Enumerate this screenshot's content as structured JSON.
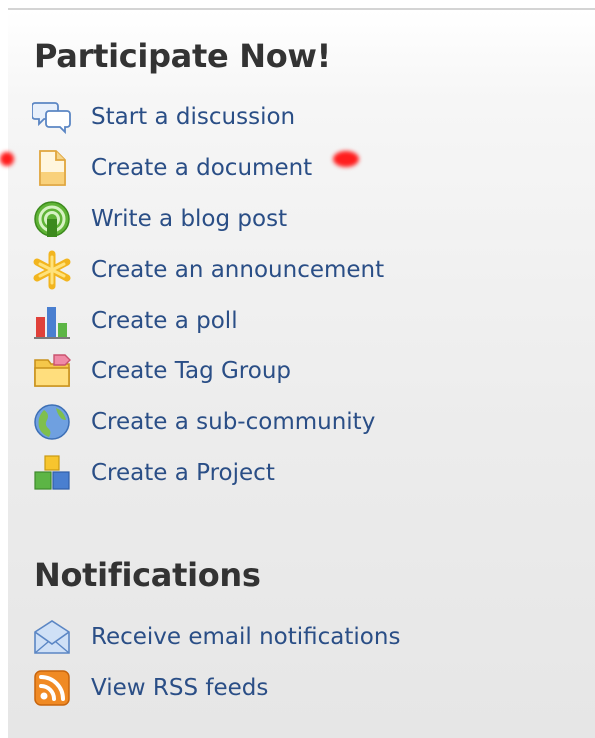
{
  "participate": {
    "title": "Participate Now!",
    "items": [
      {
        "label": "Start a discussion",
        "icon": "discussion-icon"
      },
      {
        "label": "Create a document",
        "icon": "document-icon"
      },
      {
        "label": "Write a blog post",
        "icon": "blog-post-icon"
      },
      {
        "label": "Create an announcement",
        "icon": "announcement-icon"
      },
      {
        "label": "Create a poll",
        "icon": "poll-icon"
      },
      {
        "label": "Create Tag Group",
        "icon": "tag-group-icon"
      },
      {
        "label": "Create a sub-community",
        "icon": "sub-community-icon"
      },
      {
        "label": "Create a Project",
        "icon": "project-icon"
      }
    ]
  },
  "notifications": {
    "title": "Notifications",
    "items": [
      {
        "label": "Receive email notifications",
        "icon": "email-icon"
      },
      {
        "label": "View RSS feeds",
        "icon": "rss-icon"
      }
    ]
  },
  "colors": {
    "link": "#2a4e86",
    "heading": "#333333",
    "highlight": "#ff1d1d"
  }
}
